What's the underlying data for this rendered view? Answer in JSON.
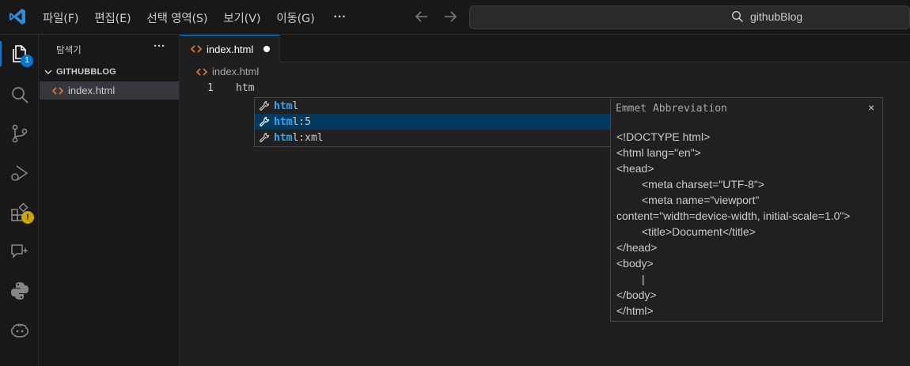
{
  "menu": {
    "items": [
      "파일(F)",
      "편집(E)",
      "선택 영역(S)",
      "보기(V)",
      "이동(G)"
    ],
    "more": "···"
  },
  "search": {
    "text": "githubBlog"
  },
  "activity": {
    "explorer_badge": "1",
    "warning_badge": "!"
  },
  "sidebar": {
    "title": "탐색기",
    "more": "···",
    "folder": "GITHUBBLOG",
    "files": [
      "index.html"
    ]
  },
  "editor": {
    "tab_label": "index.html",
    "breadcrumb": "index.html",
    "line_number": "1",
    "code": "htm"
  },
  "suggest": {
    "items": [
      {
        "match": "htm",
        "rest": "l"
      },
      {
        "match": "htm",
        "rest": "l:5"
      },
      {
        "match": "htm",
        "rest": "l:xml"
      }
    ],
    "selected_index": 1
  },
  "details": {
    "title": "Emmet Abbreviation",
    "close": "×",
    "lines": [
      "<!DOCTYPE html>",
      "<html lang=\"en\">",
      "<head>",
      "<meta charset=\"UTF-8\">",
      "<meta name=\"viewport\"",
      "content=\"width=device-width, initial-scale=1.0\">",
      "<title>Document</title>",
      "</head>",
      "<body>",
      "|",
      "</body>",
      "</html>"
    ]
  },
  "colors": {
    "accent": "#0078d4",
    "html_icon": "#e37933",
    "match_highlight": "#2aaaff",
    "selected_row": "#04395e",
    "warning": "#cca700"
  }
}
